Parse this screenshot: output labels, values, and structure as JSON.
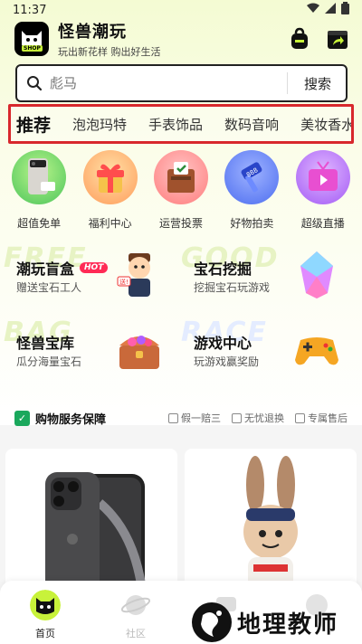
{
  "status_bar": {
    "time": "11:37"
  },
  "app": {
    "title": "怪兽潮玩",
    "slogan": "玩出新花样 购出好生活",
    "logo_tag": "SHOP"
  },
  "search": {
    "placeholder": "彪马",
    "button": "搜索"
  },
  "category_tabs": [
    {
      "label": "推荐"
    },
    {
      "label": "泡泡玛特"
    },
    {
      "label": "手表饰品"
    },
    {
      "label": "数码音响"
    },
    {
      "label": "美妆香水"
    }
  ],
  "quick_entries": [
    {
      "label": "超值免单",
      "color": "#7ed957"
    },
    {
      "label": "福利中心",
      "color": "#ffb36b"
    },
    {
      "label": "运营投票",
      "color": "#ff8a8a"
    },
    {
      "label": "好物拍卖",
      "color": "#6c8cff"
    },
    {
      "label": "超级直播",
      "color": "#b57bff"
    }
  ],
  "features": [
    {
      "title": "潮玩盲盒",
      "badge": "HOT",
      "subtitle": "赠送宝石工人",
      "bg_text": "FREE"
    },
    {
      "title": "宝石挖掘",
      "subtitle": "挖掘宝石玩游戏",
      "bg_text": "GOOD"
    },
    {
      "title": "怪兽宝库",
      "subtitle": "瓜分海量宝石",
      "bg_text": "BAG"
    },
    {
      "title": "游戏中心",
      "subtitle": "玩游戏赢奖励",
      "bg_text": "RACE"
    }
  ],
  "guarantee": {
    "title": "购物服务保障",
    "items": [
      "假一赔三",
      "无忧退换",
      "专属售后"
    ]
  },
  "bottom_nav": [
    {
      "label": "首页"
    },
    {
      "label": "社区"
    }
  ],
  "watermark": {
    "text": "地理教师"
  }
}
